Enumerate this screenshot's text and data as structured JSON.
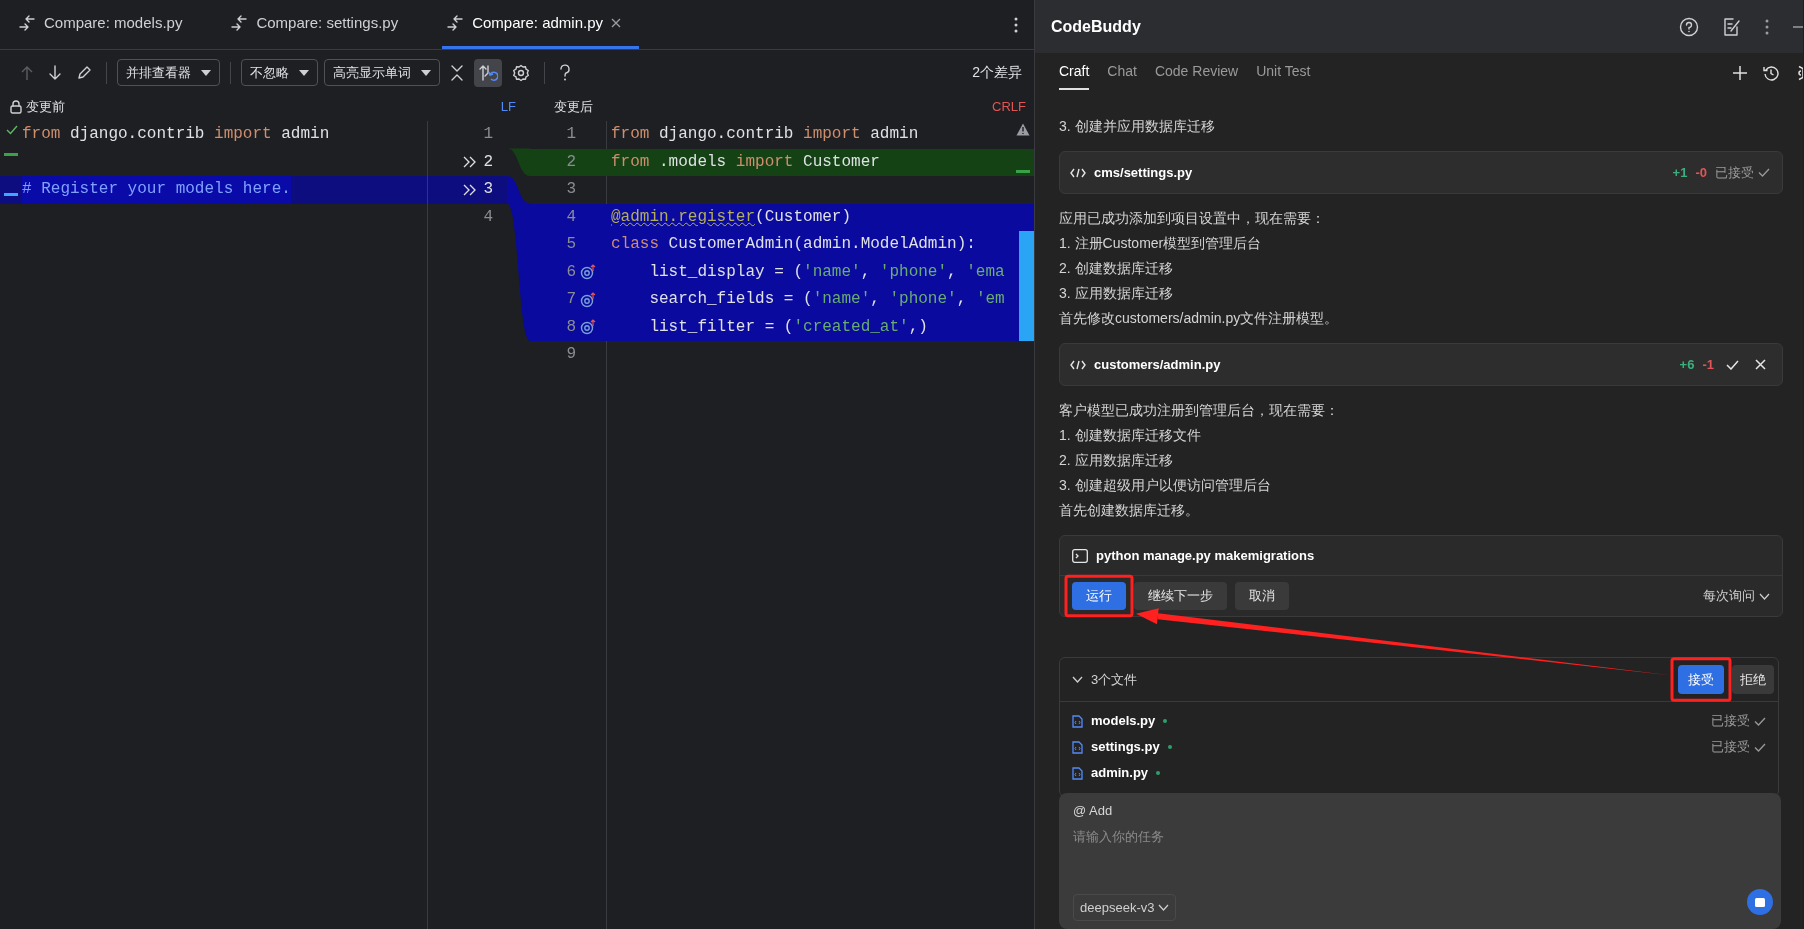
{
  "tabs": [
    {
      "label": "Compare: models.py",
      "selected": false
    },
    {
      "label": "Compare: settings.py",
      "selected": false
    },
    {
      "label": "Compare: admin.py",
      "selected": true
    }
  ],
  "toolbar": {
    "dropdowns": [
      "并排查看器",
      "不忽略",
      "高亮显示单词"
    ],
    "sync_scroll_on": true,
    "diff_count": "2个差异"
  },
  "diff": {
    "left_title": "变更前",
    "left_eol": "LF",
    "right_title": "变更后",
    "right_eol": "CRLF",
    "left_lines": [
      {
        "number": "1",
        "kind": "plain",
        "apply_arrow": false,
        "tokens": [
          {
            "kind": "kw",
            "text": "from"
          },
          {
            "kind": "plain",
            "text": " django.contrib "
          },
          {
            "kind": "kw",
            "text": "import"
          },
          {
            "kind": "plain",
            "text": " admin"
          }
        ]
      },
      {
        "number": "2",
        "kind": "insert",
        "apply_arrow": true
      },
      {
        "number": "3",
        "kind": "modified",
        "apply_arrow": true,
        "tokens": [
          {
            "kind": "comment",
            "text": "# Register your models here."
          }
        ]
      },
      {
        "number": "4",
        "kind": "plain",
        "apply_arrow": false
      }
    ],
    "right_lines": [
      {
        "number": "1",
        "kind": "plain",
        "tokens": [
          {
            "kind": "kw",
            "text": "from"
          },
          {
            "kind": "plain",
            "text": " django.contrib "
          },
          {
            "kind": "kw",
            "text": "import"
          },
          {
            "kind": "plain",
            "text": " admin"
          }
        ]
      },
      {
        "number": "2",
        "kind": "added",
        "tokens": [
          {
            "kind": "kw",
            "text": "from"
          },
          {
            "kind": "plain",
            "text": " .models "
          },
          {
            "kind": "kw",
            "text": "import"
          },
          {
            "kind": "plain",
            "text": " Customer"
          }
        ]
      },
      {
        "number": "3",
        "kind": "plain"
      },
      {
        "number": "4",
        "kind": "modified",
        "tokens": [
          {
            "kind": "deco",
            "text": "@admin.register"
          },
          {
            "kind": "plain",
            "text": "(Customer)"
          }
        ]
      },
      {
        "number": "5",
        "kind": "modified",
        "side_marker": true,
        "tokens": [
          {
            "kind": "kw",
            "text": "class"
          },
          {
            "kind": "plain",
            "text": " CustomerAdmin(admin.ModelAdmin):"
          }
        ]
      },
      {
        "number": "6",
        "kind": "modified",
        "side_marker": true,
        "gutter_icon": true,
        "tokens": [
          {
            "kind": "plain",
            "text": "    list_display = ("
          },
          {
            "kind": "str",
            "text": "'name'"
          },
          {
            "kind": "plain",
            "text": ", "
          },
          {
            "kind": "str",
            "text": "'phone'"
          },
          {
            "kind": "plain",
            "text": ", "
          },
          {
            "kind": "str",
            "text": "'ema"
          }
        ]
      },
      {
        "number": "7",
        "kind": "modified",
        "side_marker": true,
        "gutter_icon": true,
        "tokens": [
          {
            "kind": "plain",
            "text": "    search_fields = ("
          },
          {
            "kind": "str",
            "text": "'name'"
          },
          {
            "kind": "plain",
            "text": ", "
          },
          {
            "kind": "str",
            "text": "'phone'"
          },
          {
            "kind": "plain",
            "text": ", "
          },
          {
            "kind": "str",
            "text": "'em"
          }
        ]
      },
      {
        "number": "8",
        "kind": "modified",
        "side_marker": true,
        "gutter_icon": true,
        "tokens": [
          {
            "kind": "plain",
            "text": "    list_filter = ("
          },
          {
            "kind": "str",
            "text": "'created_at'"
          },
          {
            "kind": "plain",
            "text": ",)"
          }
        ]
      },
      {
        "number": "9",
        "kind": "plain"
      }
    ]
  },
  "assistant": {
    "title": "CodeBuddy",
    "tabs": [
      {
        "label": "Craft",
        "selected": true
      },
      {
        "label": "Chat",
        "selected": false
      },
      {
        "label": "Code Review",
        "selected": false
      },
      {
        "label": "Unit Test",
        "selected": false
      }
    ],
    "messages": [
      {
        "kind": "text",
        "lines": [
          "3. 创建并应用数据库迁移"
        ]
      },
      {
        "kind": "file",
        "path": "cms/settings.py",
        "added": "+1",
        "removed": "-0",
        "accepted": true,
        "status": "已接受"
      },
      {
        "kind": "text",
        "lines": [
          "应用已成功添加到项目设置中，现在需要：",
          "1. 注册Customer模型到管理后台",
          "2. 创建数据库迁移",
          "3. 应用数据库迁移",
          "首先修改customers/admin.py文件注册模型。"
        ]
      },
      {
        "kind": "file",
        "path": "customers/admin.py",
        "added": "+6",
        "removed": "-1",
        "accepted": false
      },
      {
        "kind": "text",
        "lines": [
          "客户模型已成功注册到管理后台，现在需要：",
          "1. 创建数据库迁移文件",
          "2. 应用数据库迁移",
          "3. 创建超级用户以便访问管理后台",
          "首先创建数据库迁移。"
        ]
      },
      {
        "kind": "command",
        "command": "python manage.py makemigrations",
        "buttons": [
          {
            "label": "运行",
            "primary": true
          },
          {
            "label": "继续下一步",
            "primary": false
          },
          {
            "label": "取消",
            "primary": false
          }
        ],
        "mode": "每次询问"
      }
    ],
    "changes": {
      "title": "3个文件",
      "expanded": true,
      "accept": "接受",
      "reject": "拒绝",
      "files": [
        {
          "name": "models.py",
          "status": "已接受"
        },
        {
          "name": "settings.py",
          "status": "已接受"
        },
        {
          "name": "admin.py"
        }
      ]
    },
    "input": {
      "mention": "@ Add",
      "placeholder": "请输入你的任务",
      "model": "deepseek-v3"
    }
  }
}
